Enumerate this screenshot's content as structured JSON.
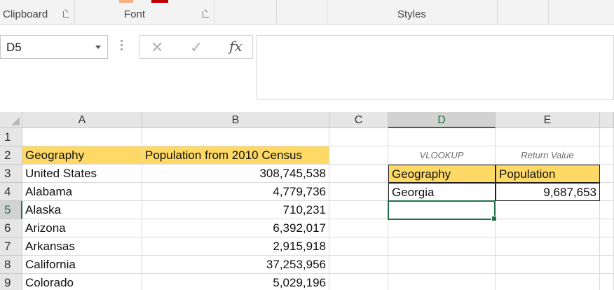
{
  "ribbon": {
    "groups": [
      "Clipboard",
      "Font",
      "Styles"
    ],
    "swatch_colors": [
      "#f4b183",
      "#c00000"
    ]
  },
  "formula_bar": {
    "name_box": "D5",
    "cancel_icon": "✕",
    "enter_icon": "✓",
    "fx_label": "fx",
    "formula": ""
  },
  "columns": [
    "A",
    "B",
    "C",
    "D",
    "E"
  ],
  "rows": [
    "1",
    "2",
    "3",
    "4",
    "5",
    "6",
    "7",
    "8",
    "9"
  ],
  "active_cell": {
    "column": "D",
    "row": "5"
  },
  "cells": {
    "A2": "Geography",
    "B2": "Population from 2010 Census",
    "A3": "United States",
    "B3": "308,745,538",
    "A4": "Alabama",
    "B4": "4,779,736",
    "A5": "Alaska",
    "B5": "710,231",
    "A6": "Arizona",
    "B6": "6,392,017",
    "A7": "Arkansas",
    "B7": "2,915,918",
    "A8": "California",
    "B8": "37,253,956",
    "A9": "Colorado",
    "B9": "5,029,196",
    "D2": "VLOOKUP",
    "E2": "Return Value",
    "D3": "Geography",
    "E3": "Population",
    "D4": "Georgia",
    "E4": "9,687,653"
  },
  "colors": {
    "header_fill": "#ffd966",
    "accent": "#217346"
  }
}
